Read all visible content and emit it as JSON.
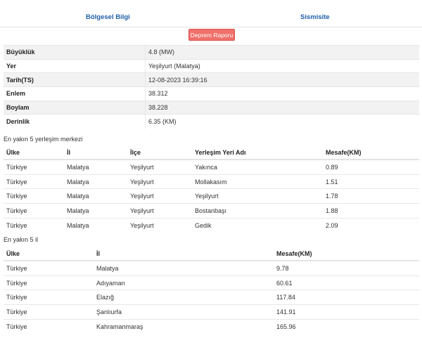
{
  "tabs": [
    "Bölgesel Bilgi",
    "Sismisite"
  ],
  "report_button": "Deprem Raporu",
  "info": [
    {
      "label": "Büyüklük",
      "value": "4.8 (MW)"
    },
    {
      "label": "Yer",
      "value": "Yeşilyurt (Malatya)"
    },
    {
      "label": "Tarih(TS)",
      "value": "12-08-2023 16:39:16"
    },
    {
      "label": "Enlem",
      "value": "38.312"
    },
    {
      "label": "Boylam",
      "value": "38.228"
    },
    {
      "label": "Derinlik",
      "value": "6.35 (KM)"
    }
  ],
  "settlements": {
    "title": "En yakın 5 yerleşim merkezi",
    "headers": [
      "Ülke",
      "İl",
      "İlçe",
      "Yerleşim Yeri Adı",
      "Mesafe(KM)"
    ],
    "rows": [
      [
        "Türkiye",
        "Malatya",
        "Yeşilyurt",
        "Yakınca",
        "0.89"
      ],
      [
        "Türkiye",
        "Malatya",
        "Yeşilyurt",
        "Mollakasım",
        "1.51"
      ],
      [
        "Türkiye",
        "Malatya",
        "Yeşilyurt",
        "Yeşilyurt",
        "1.78"
      ],
      [
        "Türkiye",
        "Malatya",
        "Yeşilyurt",
        "Bostanbaşı",
        "1.88"
      ],
      [
        "Türkiye",
        "Malatya",
        "Yeşilyurt",
        "Gedik",
        "2.09"
      ]
    ]
  },
  "cities": {
    "title": "En yakın 5 il",
    "headers": [
      "Ülke",
      "İl",
      "Mesafe(KM)"
    ],
    "rows": [
      [
        "Türkiye",
        "Malatya",
        "9.78"
      ],
      [
        "Türkiye",
        "Adıyaman",
        "60.61"
      ],
      [
        "Türkiye",
        "Elazığ",
        "117.84"
      ],
      [
        "Türkiye",
        "Şanlıurfa",
        "141.91"
      ],
      [
        "Türkiye",
        "Kahramanmaraş",
        "165.96"
      ]
    ]
  }
}
